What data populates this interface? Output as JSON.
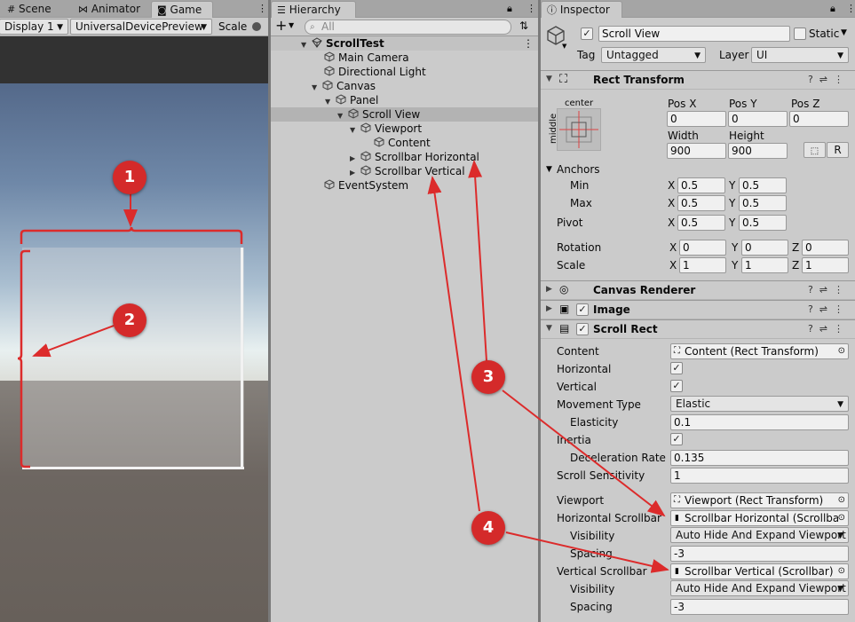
{
  "left_tabs": [
    "Scene",
    "Animator",
    "Game"
  ],
  "game_toolbar": {
    "display": "Display 1",
    "device": "UniversalDevicePreview",
    "scale": "Scale"
  },
  "hierarchy": {
    "tab": "Hierarchy",
    "search_placeholder": "All",
    "items": [
      {
        "label": "ScrollTest"
      },
      {
        "label": "Main Camera"
      },
      {
        "label": "Directional Light"
      },
      {
        "label": "Canvas"
      },
      {
        "label": "Panel"
      },
      {
        "label": "Scroll View"
      },
      {
        "label": "Viewport"
      },
      {
        "label": "Content"
      },
      {
        "label": "Scrollbar Horizontal"
      },
      {
        "label": "Scrollbar Vertical"
      },
      {
        "label": "EventSystem"
      }
    ]
  },
  "inspector": {
    "tab": "Inspector",
    "object_name": "Scroll View",
    "static_label": "Static",
    "tag_label": "Tag",
    "tag_value": "Untagged",
    "layer_label": "Layer",
    "layer_value": "UI",
    "rect_transform": {
      "title": "Rect Transform",
      "anchor_top": "center",
      "anchor_side": "middle",
      "pos_x_label": "Pos X",
      "pos_y_label": "Pos Y",
      "pos_z_label": "Pos Z",
      "pos_x": "0",
      "pos_y": "0",
      "pos_z": "0",
      "width_label": "Width",
      "height_label": "Height",
      "width": "900",
      "height": "900",
      "r_button": "R",
      "anchors_label": "Anchors",
      "min_label": "Min",
      "max_label": "Max",
      "min_x": "0.5",
      "min_y": "0.5",
      "max_x": "0.5",
      "max_y": "0.5",
      "pivot_label": "Pivot",
      "pivot_x": "0.5",
      "pivot_y": "0.5",
      "rotation_label": "Rotation",
      "rot_x": "0",
      "rot_y": "0",
      "rot_z": "0",
      "scale_label": "Scale",
      "scale_x": "1",
      "scale_y": "1",
      "scale_z": "1",
      "x": "X",
      "y": "Y",
      "z": "Z"
    },
    "canvas_renderer": {
      "title": "Canvas Renderer"
    },
    "image": {
      "title": "Image"
    },
    "scroll_rect": {
      "title": "Scroll Rect",
      "content_label": "Content",
      "content_value": "Content (Rect Transform)",
      "horizontal_label": "Horizontal",
      "vertical_label": "Vertical",
      "movement_label": "Movement Type",
      "movement_value": "Elastic",
      "elasticity_label": "Elasticity",
      "elasticity_value": "0.1",
      "inertia_label": "Inertia",
      "decel_label": "Deceleration Rate",
      "decel_value": "0.135",
      "sensitivity_label": "Scroll Sensitivity",
      "sensitivity_value": "1",
      "viewport_label": "Viewport",
      "viewport_value": "Viewport (Rect Transform)",
      "hscroll_label": "Horizontal Scrollbar",
      "hscroll_value": "Scrollbar Horizontal (Scrollbar",
      "hvis_label": "Visibility",
      "hvis_value": "Auto Hide And Expand Viewport",
      "hspacing_label": "Spacing",
      "hspacing_value": "-3",
      "vscroll_label": "Vertical Scrollbar",
      "vscroll_value": "Scrollbar Vertical (Scrollbar)",
      "vvis_label": "Visibility",
      "vvis_value": "Auto Hide And Expand Viewport",
      "vspacing_label": "Spacing",
      "vspacing_value": "-3"
    }
  },
  "callouts": [
    "1",
    "2",
    "3",
    "4"
  ],
  "colors": {
    "annotation": "#dc2b2b",
    "editor_bg": "#cbcbcb",
    "selection": "#b3b3b3"
  }
}
